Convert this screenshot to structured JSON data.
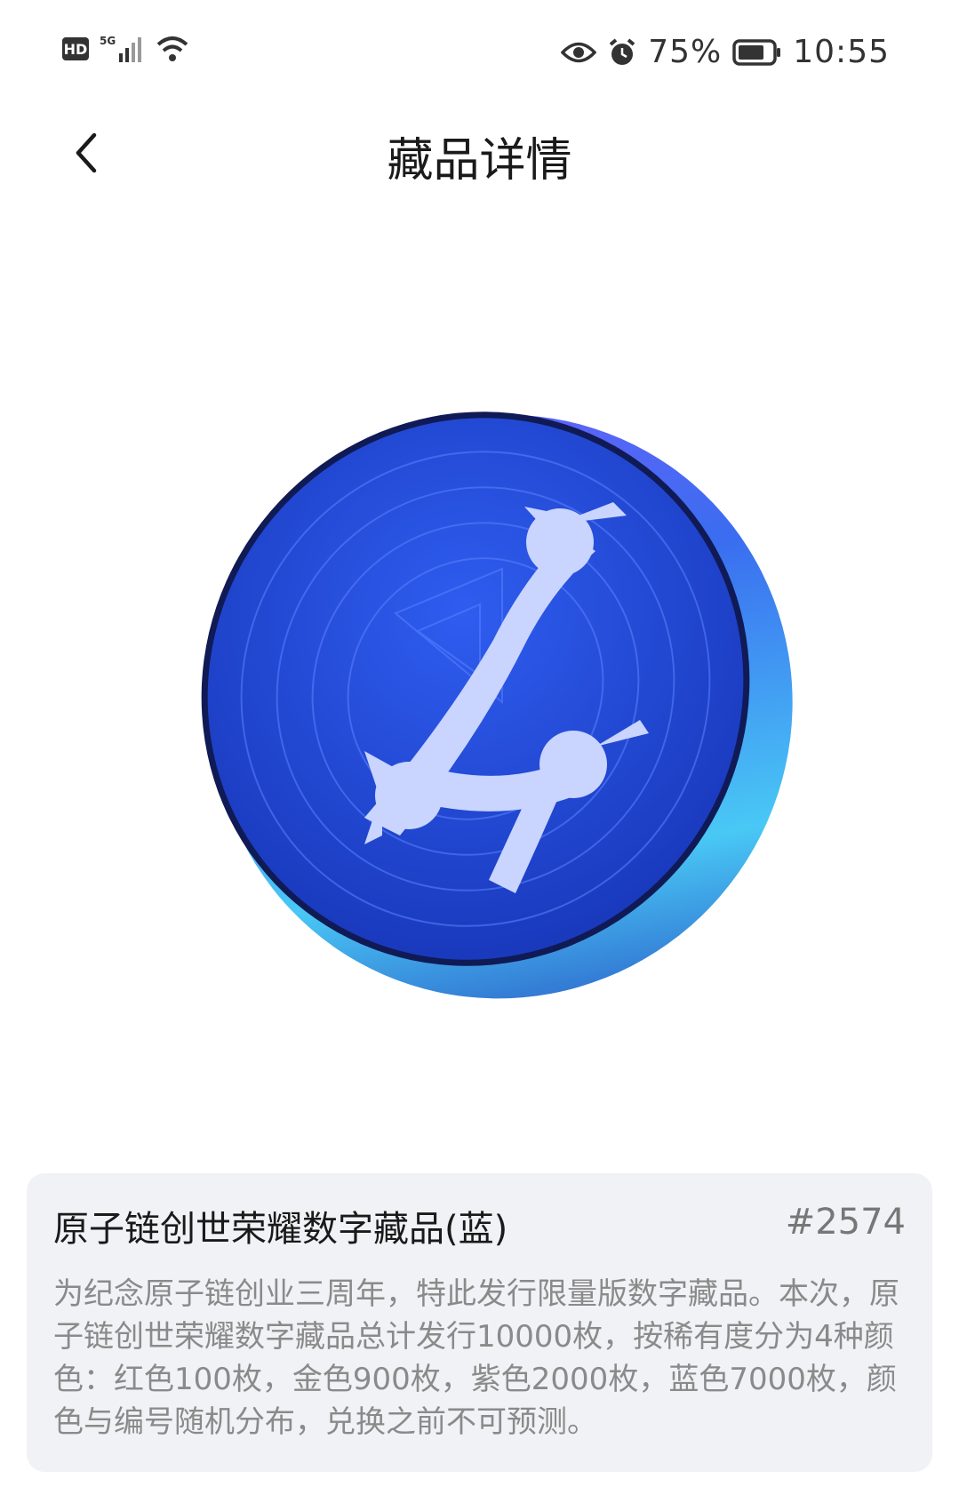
{
  "status_bar": {
    "hd": "HD",
    "network": "5G",
    "battery_percent": "75%",
    "time": "10:55",
    "icons": [
      "hd-icon",
      "signal-icon",
      "wifi-icon",
      "eye-icon",
      "alarm-icon",
      "battery-icon"
    ]
  },
  "header": {
    "title": "藏品详情",
    "back_icon": "chevron-left-icon"
  },
  "collectible": {
    "name": "原子链创世荣耀数字藏品(蓝)",
    "serial": "#2574",
    "description": "为纪念原子链创业三周年，特此发行限量版数字藏品。本次，原子链创世荣耀数字藏品总计发行10000枚，按稀有度分为4种颜色：红色100枚，金色900枚，紫色2000枚，蓝色7000枚，颜色与编号随机分布，兑换之前不可预测。",
    "coin_color": "#2046c9"
  }
}
